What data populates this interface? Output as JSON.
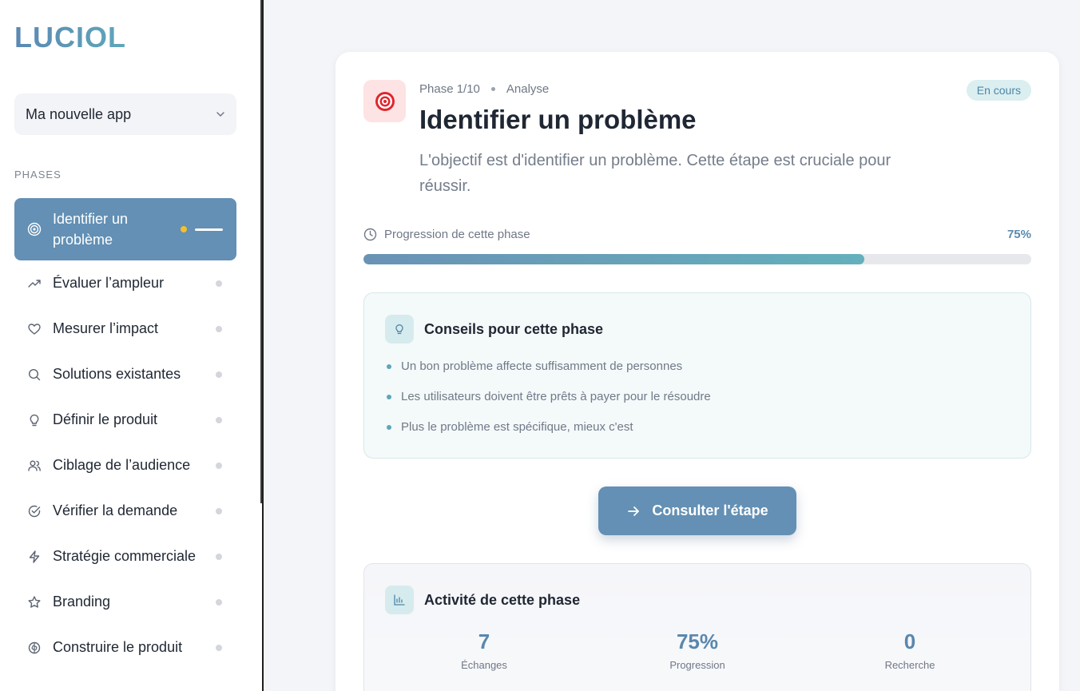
{
  "brand": {
    "logo": "LUCIOL"
  },
  "app_selector": {
    "value": "Ma nouvelle app",
    "icon": "chevron-down-icon"
  },
  "sidebar": {
    "section_label": "PHASES",
    "items": [
      {
        "label": "Identifier un problème",
        "icon": "target-icon",
        "active": true
      },
      {
        "label": "Évaluer l’ampleur",
        "icon": "trending-up-icon"
      },
      {
        "label": "Mesurer l’impact",
        "icon": "heart-icon"
      },
      {
        "label": "Solutions existantes",
        "icon": "search-icon"
      },
      {
        "label": "Définir le produit",
        "icon": "lightbulb-icon"
      },
      {
        "label": "Ciblage de l’audience",
        "icon": "users-icon"
      },
      {
        "label": "Vérifier la demande",
        "icon": "check-circle-icon"
      },
      {
        "label": "Stratégie commerciale",
        "icon": "zap-icon"
      },
      {
        "label": "Branding",
        "icon": "star-icon"
      },
      {
        "label": "Construire le produit",
        "icon": "brain-icon"
      }
    ]
  },
  "phase": {
    "counter": "Phase 1/10",
    "category": "Analyse",
    "status": "En cours",
    "title": "Identifier un problème",
    "description": "L'objectif est d'identifier un problème. Cette étape est cruciale pour réussir."
  },
  "progress": {
    "label": "Progression de cette phase",
    "percent_text": "75%",
    "value": 0.75
  },
  "tips": {
    "title": "Conseils pour cette phase",
    "items": [
      "Un bon problème affecte suffisamment de personnes",
      "Les utilisateurs doivent être prêts à payer pour le résoudre",
      "Plus le problème est spécifique, mieux c'est"
    ]
  },
  "cta": {
    "label": "Consulter l'étape"
  },
  "activity": {
    "title": "Activité de cette phase",
    "stats": [
      {
        "value": "7",
        "label": "Échanges"
      },
      {
        "value": "75%",
        "label": "Progression"
      },
      {
        "value": "0",
        "label": "Recherche"
      }
    ]
  },
  "colors": {
    "accent": "#6390b4",
    "teal": "#64b0bc",
    "active_dot": "#f4c02a",
    "target_red": "#e0262d"
  }
}
